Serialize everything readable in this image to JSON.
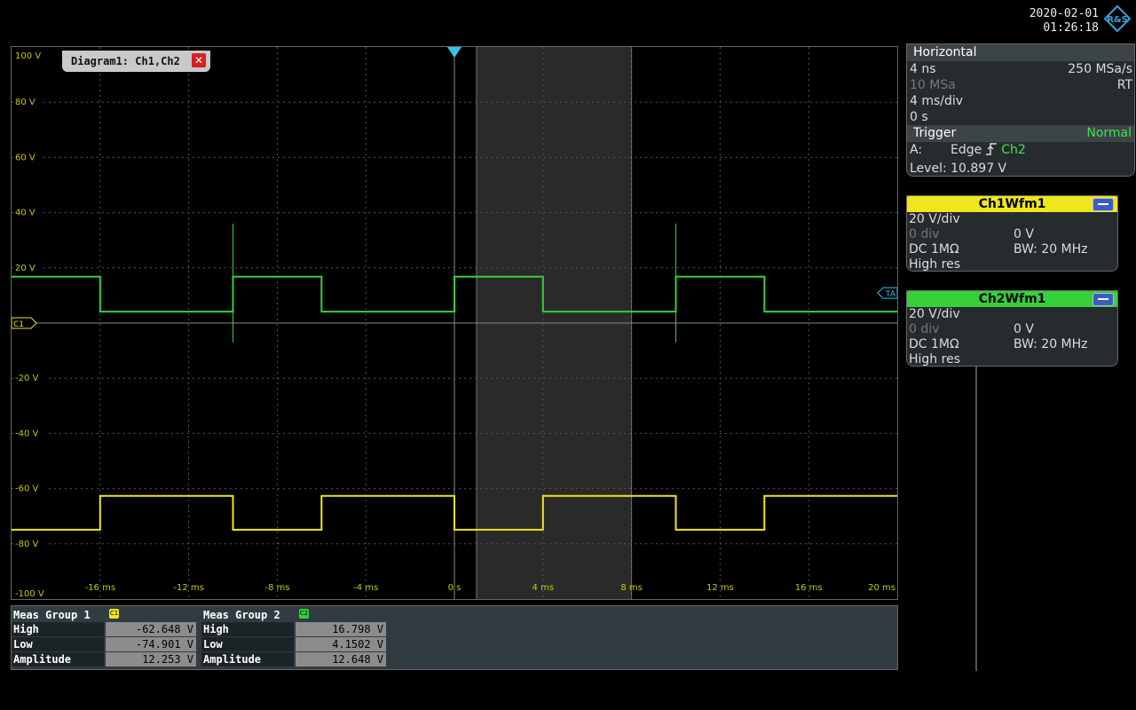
{
  "header": {
    "date": "2020-02-01",
    "time": "01:26:18",
    "logo_text": "R&S"
  },
  "diagram": {
    "tab_label": "Diagram1: Ch1,Ch2",
    "close_icon": "close-icon",
    "y_labels": [
      "100 V",
      "80 V",
      "60 V",
      "40 V",
      "20 V",
      "-20 V",
      "-40 V",
      "-60 V",
      "-80 V",
      "-100 V"
    ],
    "x_labels": [
      "-16 ms",
      "-12 ms",
      "-8 ms",
      "-4 ms",
      "0 s",
      "4 ms",
      "8 ms",
      "12 ms",
      "16 ms",
      "20 ms"
    ],
    "ch_marker": "C1",
    "trigger_marker": "TA",
    "colors": {
      "ch1": "#f0e620",
      "ch2": "#35d13a",
      "grid": "#555555",
      "zoom": "#2a2a2a"
    }
  },
  "chart_data": {
    "type": "line",
    "x_unit": "ms",
    "y_unit": "V",
    "xlim": [
      -20,
      20
    ],
    "ylim": [
      -100,
      100
    ],
    "grid": true,
    "zoom_region": [
      1,
      8
    ],
    "series": [
      {
        "name": "Ch1Wfm1",
        "x": [
          -20,
          -16,
          -16,
          -10,
          -10,
          -6,
          -6,
          0,
          0,
          4,
          4,
          10,
          10,
          14,
          14,
          20
        ],
        "y": [
          -74.9,
          -74.9,
          -62.6,
          -62.6,
          -74.9,
          -74.9,
          -62.6,
          -62.6,
          -74.9,
          -74.9,
          -62.6,
          -62.6,
          -74.9,
          -74.9,
          -62.6,
          -62.6
        ]
      },
      {
        "name": "Ch2Wfm1",
        "x": [
          -20,
          -16,
          -16,
          -10,
          -10,
          -6,
          -6,
          0,
          0,
          4,
          4,
          10,
          10,
          14,
          14,
          20
        ],
        "y": [
          16.8,
          16.8,
          4.15,
          4.15,
          16.8,
          16.8,
          4.15,
          4.15,
          16.8,
          16.8,
          4.15,
          4.15,
          16.8,
          16.8,
          4.15,
          4.15
        ]
      }
    ]
  },
  "meas": {
    "groups": [
      {
        "title": "Meas Group 1",
        "badge": "C1",
        "badge_color": "#f0e620",
        "rows": [
          {
            "label": "High",
            "value": "-62.648 V"
          },
          {
            "label": "Low",
            "value": "-74.901 V"
          },
          {
            "label": "Amplitude",
            "value": "12.253 V"
          }
        ]
      },
      {
        "title": "Meas Group 2",
        "badge": "C2",
        "badge_color": "#35d13a",
        "rows": [
          {
            "label": "High",
            "value": "16.798 V"
          },
          {
            "label": "Low",
            "value": "4.1502 V"
          },
          {
            "label": "Amplitude",
            "value": "12.648 V"
          }
        ]
      }
    ]
  },
  "horizontal": {
    "title": "Horizontal",
    "resolution": "4 ns",
    "sample_rate": "250 MSa/s",
    "record_length": "10 MSa",
    "mode": "RT",
    "time_scale": "4 ms/div",
    "position": "0 s",
    "trigger_title": "Trigger",
    "trigger_mode": "Normal",
    "trigger_slot": "A:",
    "trigger_type": "Edge",
    "trigger_source": "Ch2",
    "trigger_level": "Level: 10.897 V"
  },
  "channels": [
    {
      "title": "Ch1Wfm1",
      "color": "#f0e620",
      "scale": "20 V/div",
      "offset_div": "0 div",
      "offset_v": "0 V",
      "coupling": "DC 1MΩ",
      "bw": "BW: 20 MHz",
      "mode": "High res"
    },
    {
      "title": "Ch2Wfm1",
      "color": "#35d13a",
      "scale": "20 V/div",
      "offset_div": "0 div",
      "offset_v": "0 V",
      "coupling": "DC 1MΩ",
      "bw": "BW: 20 MHz",
      "mode": "High res"
    }
  ]
}
